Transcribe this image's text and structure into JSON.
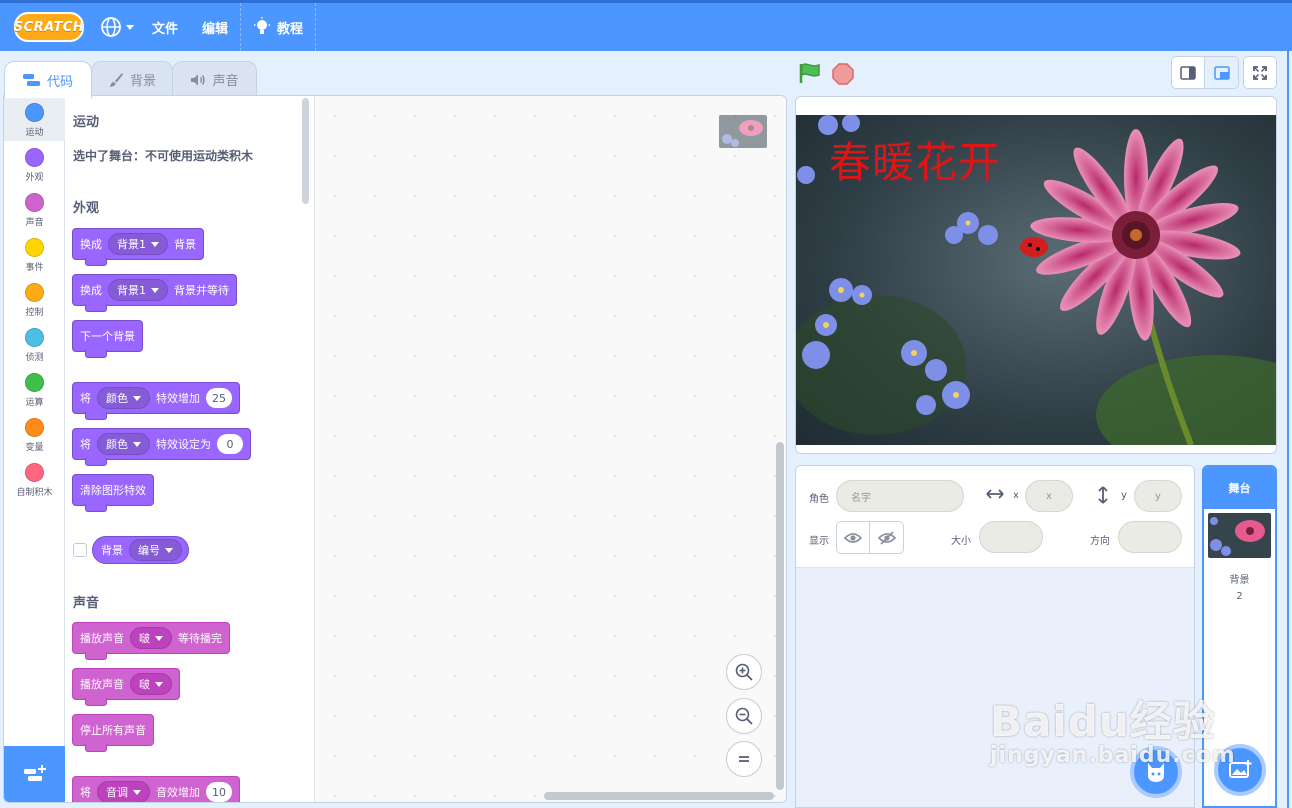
{
  "menubar": {
    "logo": "SCRATCH",
    "file": "文件",
    "edit": "编辑",
    "tutorials": "教程"
  },
  "tabs": {
    "code": "代码",
    "costumes": "背景",
    "sounds": "声音"
  },
  "categories": [
    {
      "label": "运动",
      "color": "#4c97ff"
    },
    {
      "label": "外观",
      "color": "#9966ff"
    },
    {
      "label": "声音",
      "color": "#cf63cf"
    },
    {
      "label": "事件",
      "color": "#ffd500"
    },
    {
      "label": "控制",
      "color": "#ffab19"
    },
    {
      "label": "侦测",
      "color": "#4cbfe6"
    },
    {
      "label": "运算",
      "color": "#40bf4a"
    },
    {
      "label": "变量",
      "color": "#ff8c1a"
    },
    {
      "label": "自制积木",
      "color": "#ff6680"
    }
  ],
  "palette": {
    "motion_title": "运动",
    "motion_note": "选中了舞台：不可使用运动类积木",
    "looks_title": "外观",
    "switch_backdrop": {
      "text1": "换成",
      "dropdown": "背景1",
      "text2": "背景"
    },
    "switch_backdrop_wait": {
      "text1": "换成",
      "dropdown": "背景1",
      "text2": "背景并等待"
    },
    "next_backdrop": "下一个背景",
    "change_effect": {
      "text1": "将",
      "dropdown": "颜色",
      "text2": "特效增加",
      "value": "25"
    },
    "set_effect": {
      "text1": "将",
      "dropdown": "颜色",
      "text2": "特效设定为",
      "value": "0"
    },
    "clear_effects": "清除图形特效",
    "backdrop_reporter": {
      "text": "背景",
      "dropdown": "编号"
    },
    "sound_title": "声音",
    "play_until_done": {
      "text1": "播放声音",
      "dropdown": "啵",
      "text2": "等待播完"
    },
    "start_sound": {
      "text1": "播放声音",
      "dropdown": "啵"
    },
    "stop_all_sounds": "停止所有声音",
    "change_sound_effect": {
      "text1": "将",
      "dropdown": "音调",
      "text2": "音效增加",
      "value": "10"
    }
  },
  "stage": {
    "text": "春暖花开"
  },
  "sprite_info": {
    "sprite_label": "角色",
    "name_placeholder": "名字",
    "x_label": "x",
    "x_placeholder": "x",
    "y_label": "y",
    "y_placeholder": "y",
    "show_label": "显示",
    "size_label": "大小",
    "direction_label": "方向"
  },
  "target": {
    "header": "舞台",
    "backdrop_label": "背景",
    "backdrop_count": "2"
  },
  "watermark": {
    "main": "Baidu经验",
    "sub": "jingyan.baidu.com"
  },
  "colors": {
    "primary": "#4c97ff",
    "looks": "#9966ff",
    "sound": "#cf63cf",
    "stage_text": "#e01414"
  }
}
